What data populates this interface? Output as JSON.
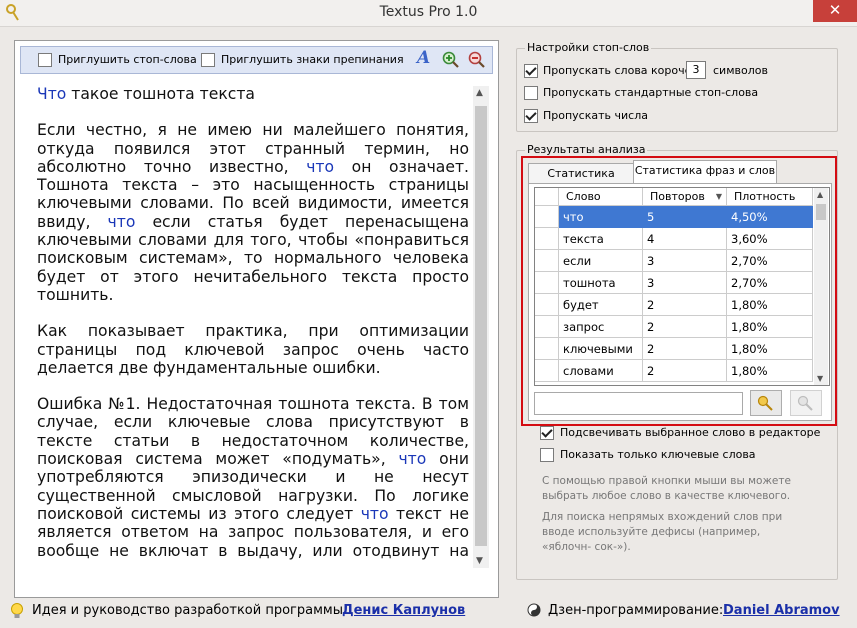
{
  "window": {
    "title": "Textus Pro 1.0",
    "close_glyph": "✕"
  },
  "editor": {
    "toolbar": {
      "checkbox1_label": "Приглушить стоп-слова",
      "checkbox2_label": "Приглушить знаки препинания",
      "icons": [
        "font-icon",
        "zoom-in-icon",
        "zoom-out-icon"
      ],
      "font_glyph": "A"
    },
    "paragraphs": [
      [
        {
          "t": "Что",
          "kw": true
        },
        {
          "t": " такое тошнота текста"
        }
      ],
      [
        {
          "t": "Если честно, я не имею ни малейшего понятия, откуда появился этот странный термин, но абсолютно точно известно, "
        },
        {
          "t": "что",
          "kw": true
        },
        {
          "t": " он означает. Тошнота текста – это насыщенность страницы ключевыми словами. По всей видимости, имеется ввиду, "
        },
        {
          "t": "что",
          "kw": true
        },
        {
          "t": " если статья будет перенасыщена ключевыми словами для того, чтобы «понравиться поисковым системам», то нормального человека будет от этого нечитабельного текста просто тошнить."
        }
      ],
      [
        {
          "t": "Как показывает практика, при оптимизации страницы под ключевой запрос очень часто делается две фундаментальные ошибки."
        }
      ],
      [
        {
          "t": "Ошибка №1. Недостаточная тошнота текста. В том случае, если ключевые слова присутствуют в тексте статьи в недостаточном количестве, поисковая система может «подумать», "
        },
        {
          "t": "что",
          "kw": true
        },
        {
          "t": " они употребляются эпизодически и не несут существенной смысловой нагрузки. По логике поисковой системы из этого следует "
        },
        {
          "t": "что",
          "kw": true
        },
        {
          "t": " текст не является ответом на запрос пользователя, и его вообще не включат в выдачу, или отодвинут на последние позиции."
        }
      ]
    ]
  },
  "stopwords": {
    "title": "Настройки стоп-слов",
    "skip_short_label": "Пропускать слова короче",
    "skip_short_value": "3",
    "skip_short_unit": "символов",
    "skip_standard_label": "Пропускать стандартные стоп-слова",
    "skip_numbers_label": "Пропускать числа"
  },
  "results": {
    "title": "Результаты анализа",
    "tabs": [
      "Статистика текста",
      "Статистика фраз и слов"
    ],
    "columns": [
      "Слово (фра...",
      "Повторов",
      "Плотность"
    ],
    "rows": [
      [
        "что",
        "5",
        "4,50%"
      ],
      [
        "текста",
        "4",
        "3,60%"
      ],
      [
        "если",
        "3",
        "2,70%"
      ],
      [
        "тошнота",
        "3",
        "2,70%"
      ],
      [
        "будет",
        "2",
        "1,80%"
      ],
      [
        "запрос",
        "2",
        "1,80%"
      ],
      [
        "ключевыми",
        "2",
        "1,80%"
      ],
      [
        "словами",
        "2",
        "1,80%"
      ]
    ],
    "search_value": "",
    "highlight_label": "Подсвечивать выбранное слово в редакторе",
    "only_keywords_label": "Показать только ключевые слова",
    "info1": "С помощью правой кнопки мыши вы можете выбрать любое слово в качестве ключевого.",
    "info2": "Для поиска непрямых вхождений слов при вводе используйте дефисы (например, «яблочн- сок-»)."
  },
  "footer": {
    "idea_label": "Идея и руководство разработкой программы:",
    "idea_author": "Денис Каплунов",
    "zen_label": "Дзен-программирование:",
    "zen_author": "Daniel Abramov"
  },
  "colors": {
    "accent_selection": "#3f78d2",
    "highlight_frame": "#d40c12",
    "keyword": "#1a37b8"
  }
}
